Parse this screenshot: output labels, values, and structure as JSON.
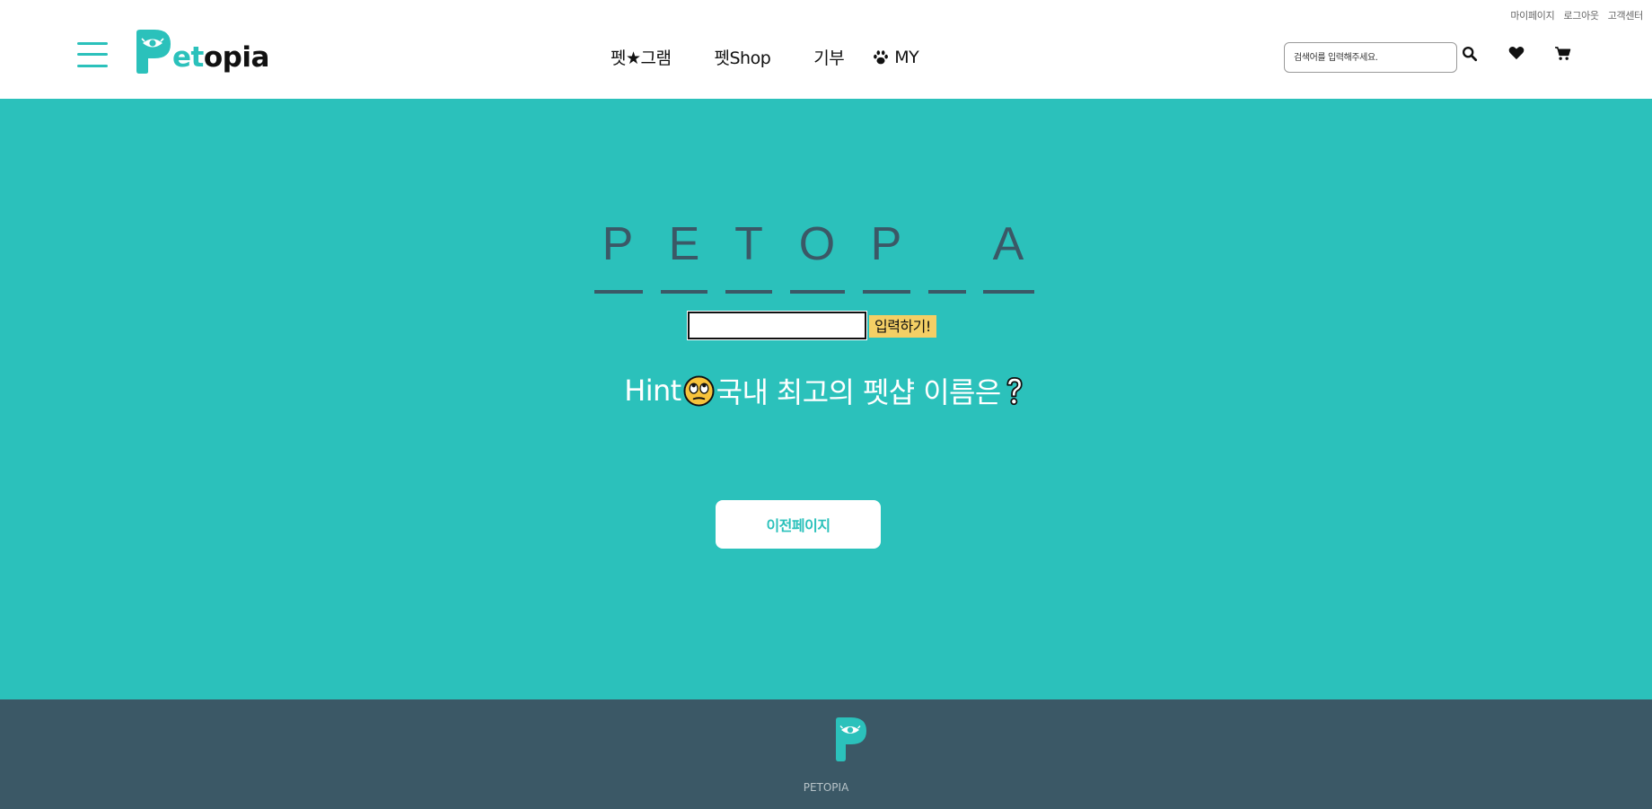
{
  "header": {
    "util_links": [
      "마이페이지",
      "로그아웃",
      "고객센터"
    ],
    "logo": {
      "letter": "P",
      "et": "et",
      "opia": "opia"
    },
    "nav": [
      "펫★그램",
      "펫Shop",
      "기부",
      "MY"
    ],
    "search": {
      "placeholder": "검색어를 입력해주세요."
    },
    "icons": [
      "menu-icon",
      "search-icon",
      "heart-icon",
      "cart-icon",
      "paw-icon"
    ]
  },
  "game": {
    "letters": [
      "P",
      "E",
      "T",
      "O",
      "P",
      "",
      "A"
    ],
    "answer_value": "",
    "submit_label": "입력하기!",
    "hint_prefix": "Hint",
    "hint_text": " 국내 최고의 펫샵 이름은",
    "hint_emoji": "eye-roll-emoji",
    "hint_question": "question-mark-emoji",
    "prev_label": "이전페이지"
  },
  "footer": {
    "name": "PETOPIA"
  },
  "colors": {
    "brand_teal": "#2bc1bb",
    "dark_slate": "#3b5866",
    "submit_yellow": "#f4cf65"
  }
}
